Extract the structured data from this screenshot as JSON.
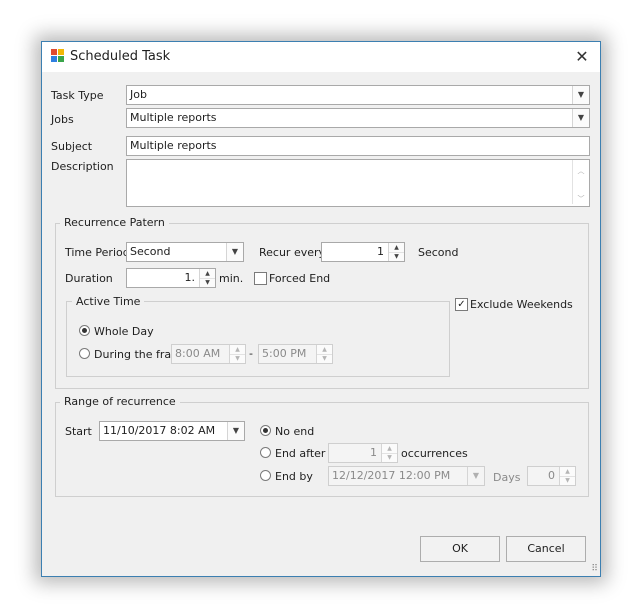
{
  "window": {
    "title": "Scheduled Task",
    "icon": "app-icon",
    "close_icon": "close-icon"
  },
  "form": {
    "task_type": {
      "label": "Task Type",
      "value": "Job"
    },
    "jobs": {
      "label": "Jobs",
      "value": "Multiple reports"
    },
    "subject": {
      "label": "Subject",
      "value": "Multiple reports"
    },
    "description": {
      "label": "Description",
      "value": ""
    }
  },
  "recurrence": {
    "group_title": "Recurrence Patern",
    "time_period_label": "Time Period",
    "time_period_value": "Second",
    "recur_every_label": "Recur every",
    "recur_every_value": "1",
    "recur_unit": "Second",
    "duration_label": "Duration",
    "duration_value": "1.",
    "duration_unit": "min.",
    "forced_end_label": "Forced End",
    "forced_end_checked": false,
    "exclude_weekends_label": "Exclude Weekends",
    "exclude_weekends_checked": true,
    "active_time": {
      "group_title": "Active Time",
      "whole_day_label": "Whole Day",
      "whole_day_selected": true,
      "during_label": "During the fram",
      "from_time": "8:00 AM",
      "separator": "-",
      "to_time": "5:00 PM"
    }
  },
  "range": {
    "group_title": "Range of recurrence",
    "start_label": "Start",
    "start_value": "11/10/2017 8:02 AM",
    "no_end_label": "No end",
    "no_end_selected": true,
    "end_after_label": "End after",
    "end_after_value": "1",
    "occurrences_label": "occurrences",
    "end_by_label": "End by",
    "end_by_value": "12/12/2017 12:00 PM",
    "days_label": "Days",
    "days_value": "0"
  },
  "buttons": {
    "ok": "OK",
    "cancel": "Cancel"
  },
  "glyphs": {
    "down": "▼",
    "up": "▲",
    "check": "✓",
    "close": "✕",
    "scroll_up": "︿",
    "scroll_down": "﹀",
    "grip": "⠿"
  }
}
